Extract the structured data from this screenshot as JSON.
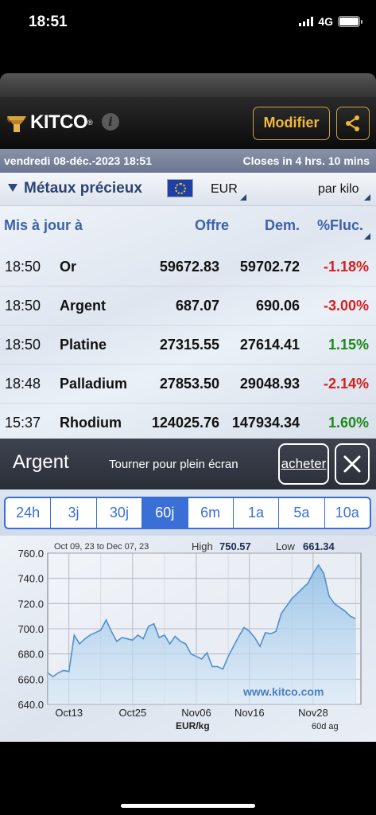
{
  "status": {
    "time": "18:51",
    "network": "4G"
  },
  "header": {
    "brand": "KITCO",
    "reg": "®",
    "info": "i",
    "modify_label": "Modifier"
  },
  "date_bar": {
    "date": "vendredi 08-déc.-2023 18:51",
    "closes": "Closes in 4 hrs. 10 mins"
  },
  "selector": {
    "category": "Métaux précieux",
    "currency": "EUR",
    "unit": "par kilo"
  },
  "table": {
    "headers": {
      "time": "Mis à jour à",
      "offer": "Offre",
      "ask": "Dem.",
      "change": "%Fluc."
    },
    "rows": [
      {
        "time": "18:50",
        "name": "Or",
        "offer": "59672.83",
        "ask": "59702.72",
        "change": "-1.18%",
        "dir": "neg"
      },
      {
        "time": "18:50",
        "name": "Argent",
        "offer": "687.07",
        "ask": "690.06",
        "change": "-3.00%",
        "dir": "neg"
      },
      {
        "time": "18:50",
        "name": "Platine",
        "offer": "27315.55",
        "ask": "27614.41",
        "change": "1.15%",
        "dir": "pos"
      },
      {
        "time": "18:48",
        "name": "Palladium",
        "offer": "27853.50",
        "ask": "29048.93",
        "change": "-2.14%",
        "dir": "neg"
      },
      {
        "time": "15:37",
        "name": "Rhodium",
        "offer": "124025.76",
        "ask": "147934.34",
        "change": "1.60%",
        "dir": "pos"
      }
    ]
  },
  "chart_panel": {
    "title": "Argent",
    "hint": "Tourner pour plein écran",
    "buy_label": "acheter",
    "tabs": [
      "24h",
      "3j",
      "30j",
      "60j",
      "6m",
      "1a",
      "5a",
      "10a"
    ],
    "active_tab": "60j"
  },
  "chart_data": {
    "type": "area",
    "range_label": "Oct 09, 23 to Dec 07, 23",
    "high_label": "High",
    "high": "750.57",
    "low_label": "Low",
    "low": "661.34",
    "ylabel": "EUR/kg",
    "corner_label": "60d ag",
    "watermark": "www.kitco.com",
    "ylim": [
      640,
      760
    ],
    "y_ticks": [
      "760.0",
      "740.0",
      "720.0",
      "700.0",
      "680.0",
      "660.0",
      "640.0"
    ],
    "x_ticks": [
      "Oct13",
      "Oct25",
      "Nov06",
      "Nov16",
      "Nov28"
    ],
    "x_tick_days": [
      4,
      16,
      28,
      38,
      50
    ],
    "x_max_day": 59,
    "points": [
      [
        0,
        665
      ],
      [
        1,
        662
      ],
      [
        2,
        665
      ],
      [
        3,
        667
      ],
      [
        4,
        666
      ],
      [
        5,
        695
      ],
      [
        6,
        688
      ],
      [
        7,
        692
      ],
      [
        8,
        695
      ],
      [
        9,
        697
      ],
      [
        10,
        699
      ],
      [
        11,
        707
      ],
      [
        12,
        698
      ],
      [
        13,
        690
      ],
      [
        14,
        693
      ],
      [
        15,
        692
      ],
      [
        16,
        691
      ],
      [
        17,
        695
      ],
      [
        18,
        692
      ],
      [
        19,
        702
      ],
      [
        20,
        704
      ],
      [
        21,
        693
      ],
      [
        22,
        695
      ],
      [
        23,
        688
      ],
      [
        24,
        694
      ],
      [
        25,
        690
      ],
      [
        26,
        688
      ],
      [
        27,
        680
      ],
      [
        28,
        678
      ],
      [
        29,
        676
      ],
      [
        30,
        681
      ],
      [
        31,
        670
      ],
      [
        32,
        670
      ],
      [
        33,
        668
      ],
      [
        34,
        678
      ],
      [
        35,
        686
      ],
      [
        36,
        694
      ],
      [
        37,
        701
      ],
      [
        38,
        698
      ],
      [
        39,
        693
      ],
      [
        40,
        686
      ],
      [
        41,
        697
      ],
      [
        42,
        696
      ],
      [
        43,
        698
      ],
      [
        44,
        712
      ],
      [
        45,
        718
      ],
      [
        46,
        724
      ],
      [
        47,
        728
      ],
      [
        48,
        732
      ],
      [
        49,
        736
      ],
      [
        50,
        744
      ],
      [
        51,
        750.57
      ],
      [
        52,
        744
      ],
      [
        53,
        726
      ],
      [
        54,
        720
      ],
      [
        55,
        717
      ],
      [
        56,
        714
      ],
      [
        57,
        710
      ],
      [
        58,
        708
      ]
    ]
  },
  "colors": {
    "accent_blue": "#3a6fd8",
    "header_label_blue": "#3d62a8",
    "gold": "#f0b73c",
    "negative": "#d42020",
    "positive": "#1a8a1a",
    "chart_line": "#4f8fcf"
  },
  "icons": {
    "share": "share-icon",
    "close": "close-icon",
    "dropdown": "disclosure-triangle-icon",
    "flag": "eu-flag-icon"
  }
}
